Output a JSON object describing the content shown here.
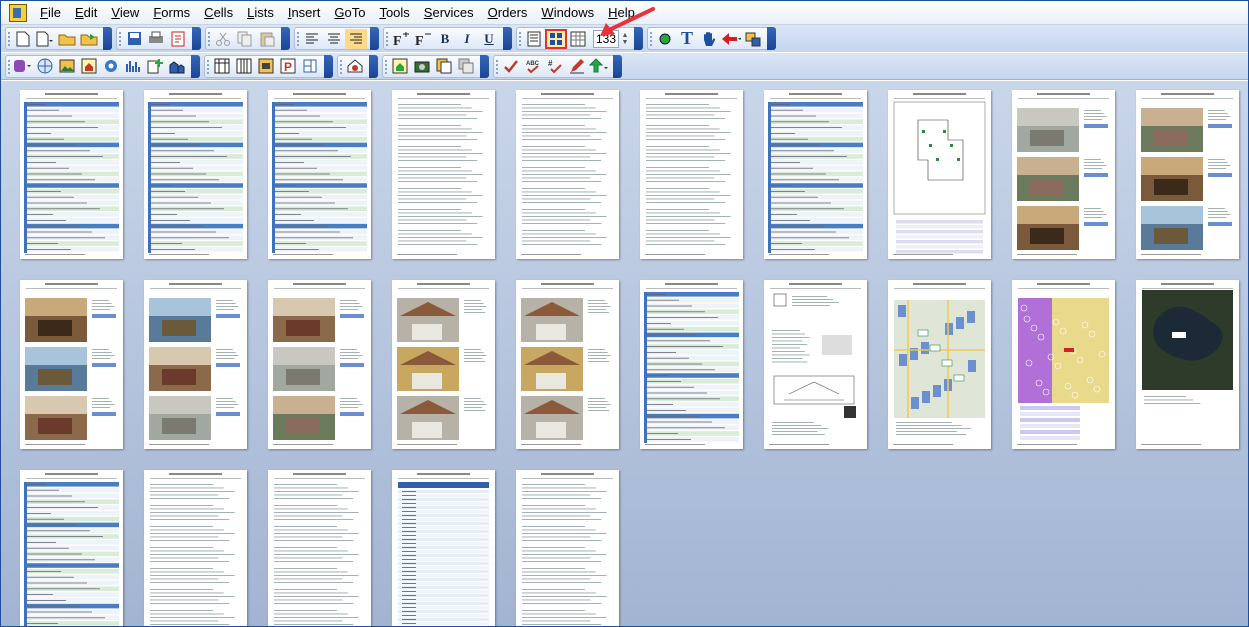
{
  "menu": [
    {
      "label": "File"
    },
    {
      "label": "Edit"
    },
    {
      "label": "View"
    },
    {
      "label": "Forms"
    },
    {
      "label": "Cells"
    },
    {
      "label": "Lists"
    },
    {
      "label": "Insert"
    },
    {
      "label": "GoTo"
    },
    {
      "label": "Tools"
    },
    {
      "label": "Services"
    },
    {
      "label": "Orders"
    },
    {
      "label": "Windows"
    },
    {
      "label": "Help"
    }
  ],
  "toolbar": {
    "bold_label": "B",
    "italic_label": "I",
    "underline_label": "U",
    "zoom_value": "133",
    "text_tool_label": "T",
    "selected_button": "thumbnail-view-button",
    "highlight_color": "#e03030",
    "annotation_arrow_color": "#e8333b"
  },
  "pages": [
    {
      "kind": "form"
    },
    {
      "kind": "form"
    },
    {
      "kind": "form"
    },
    {
      "kind": "text"
    },
    {
      "kind": "text"
    },
    {
      "kind": "text"
    },
    {
      "kind": "form"
    },
    {
      "kind": "sketch"
    },
    {
      "kind": "photos"
    },
    {
      "kind": "photos"
    },
    {
      "kind": "photos"
    },
    {
      "kind": "photos"
    },
    {
      "kind": "photos"
    },
    {
      "kind": "comps"
    },
    {
      "kind": "comps"
    },
    {
      "kind": "form"
    },
    {
      "kind": "license"
    },
    {
      "kind": "map"
    },
    {
      "kind": "flood-map"
    },
    {
      "kind": "aerial"
    },
    {
      "kind": "form"
    },
    {
      "kind": "text"
    },
    {
      "kind": "text"
    },
    {
      "kind": "table"
    },
    {
      "kind": "text"
    }
  ]
}
